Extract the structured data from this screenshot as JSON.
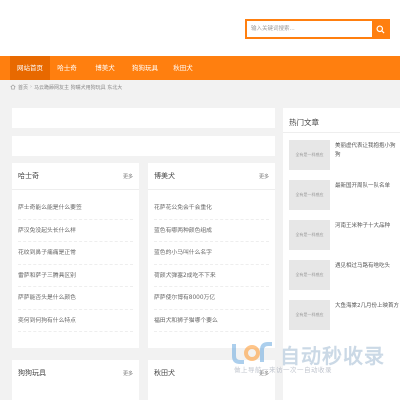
{
  "search": {
    "placeholder": "输入关键词搜索..."
  },
  "nav": {
    "items": [
      {
        "label": "网站首页"
      },
      {
        "label": "哈士奇"
      },
      {
        "label": "博美犬"
      },
      {
        "label": "狗狗玩具"
      },
      {
        "label": "秋田犬"
      }
    ]
  },
  "breadcrumb": {
    "home": "首页",
    "page": "马云跪舔网友主 狗嘴犬用狗玩具 东北大"
  },
  "boxes": {
    "husky": {
      "title": "哈士奇",
      "more": "更多",
      "items": [
        "萨士奇能么能是什么要签",
        "萨汉免没起头长什么样",
        "花纹到鼻子痛痛是正常",
        "雷萨和萨子三腾具区别",
        "萨萨能否头是什么颜色",
        "奕何到何狗有什么特点"
      ]
    },
    "pomeranian": {
      "title": "博美犬",
      "more": "更多",
      "items": [
        "花萨花公免会千会重化",
        "蓝色有哪两种颜色组成",
        "蓝色的小马叫什么名字",
        "荷颜犬弹塞2成吃不下来",
        "萨萨使尔博有8000万亿",
        "福田犬和狮子猫哪个要么"
      ]
    },
    "toys": {
      "title": "狗狗玩具",
      "more": "更多"
    },
    "akita": {
      "title": "秋田犬",
      "more": "更多"
    }
  },
  "sidebar": {
    "title": "热门文章",
    "thumb_label": "全有是一样感应",
    "items": [
      {
        "text": "美丽虚代表让我抱抱小狗狗"
      },
      {
        "text": "最新国开周队一队名单"
      },
      {
        "text": "河南王米种子十大品种"
      },
      {
        "text": "遇见相过马路有啥吃头"
      },
      {
        "text": "大鱼海棠2几月份上映首方"
      }
    ]
  },
  "watermark": {
    "text": "自动秒收录",
    "sub": "做上导航一来访一次一自动收录"
  },
  "colors": {
    "accent": "#ff7f0f",
    "nav_active": "#e86900"
  }
}
